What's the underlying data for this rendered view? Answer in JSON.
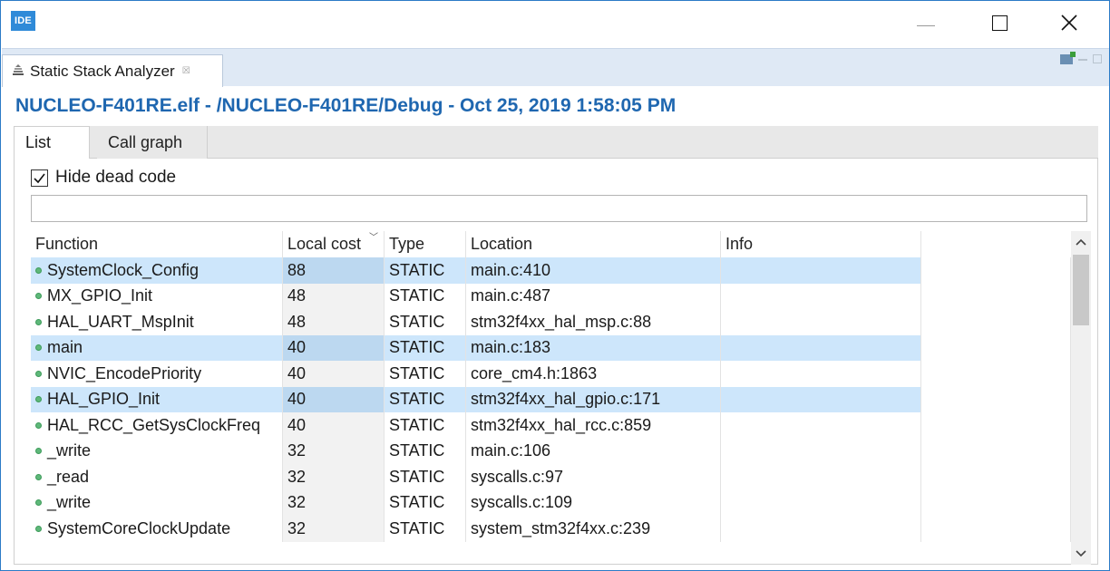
{
  "window": {
    "app_icon_text": "IDE",
    "minimize_icon": "minimize-icon",
    "maximize_icon": "maximize-icon",
    "close_glyph": "✕"
  },
  "view_tab": {
    "icon": "stack-analyzer-icon",
    "label": "Static Stack Analyzer",
    "close_glyph": "☒"
  },
  "header": {
    "title": "NUCLEO-F401RE.elf - /NUCLEO-F401RE/Debug - Oct 25, 2019 1:58:05 PM"
  },
  "tabs": [
    {
      "label": "List",
      "active": true
    },
    {
      "label": "Call graph",
      "active": false
    }
  ],
  "filter": {
    "hide_dead_code_label": "Hide dead code",
    "hide_dead_code_checked": true,
    "search_value": ""
  },
  "table": {
    "columns": [
      "Function",
      "Local cost",
      "Type",
      "Location",
      "Info"
    ],
    "sorted_column": "Local cost",
    "rows": [
      {
        "function": "SystemClock_Config",
        "cost": "88",
        "type": "STATIC",
        "location": "main.c:410",
        "info": "",
        "selected": true
      },
      {
        "function": "MX_GPIO_Init",
        "cost": "48",
        "type": "STATIC",
        "location": "main.c:487",
        "info": "",
        "selected": false
      },
      {
        "function": "HAL_UART_MspInit",
        "cost": "48",
        "type": "STATIC",
        "location": "stm32f4xx_hal_msp.c:88",
        "info": "",
        "selected": false
      },
      {
        "function": "main",
        "cost": "40",
        "type": "STATIC",
        "location": "main.c:183",
        "info": "",
        "selected": true
      },
      {
        "function": "NVIC_EncodePriority",
        "cost": "40",
        "type": "STATIC",
        "location": "core_cm4.h:1863",
        "info": "",
        "selected": false
      },
      {
        "function": "HAL_GPIO_Init",
        "cost": "40",
        "type": "STATIC",
        "location": "stm32f4xx_hal_gpio.c:171",
        "info": "",
        "selected": true
      },
      {
        "function": "HAL_RCC_GetSysClockFreq",
        "cost": "40",
        "type": "STATIC",
        "location": "stm32f4xx_hal_rcc.c:859",
        "info": "",
        "selected": false
      },
      {
        "function": "_write",
        "cost": "32",
        "type": "STATIC",
        "location": "main.c:106",
        "info": "",
        "selected": false
      },
      {
        "function": "_read",
        "cost": "32",
        "type": "STATIC",
        "location": "syscalls.c:97",
        "info": "",
        "selected": false
      },
      {
        "function": "_write",
        "cost": "32",
        "type": "STATIC",
        "location": "syscalls.c:109",
        "info": "",
        "selected": false
      },
      {
        "function": "SystemCoreClockUpdate",
        "cost": "32",
        "type": "STATIC",
        "location": "system_stm32f4xx.c:239",
        "info": "",
        "selected": false
      }
    ]
  },
  "colors": {
    "accent_title": "#1f67b0",
    "selection": "#cde6fb",
    "status_dot": "#5fb87a",
    "window_border": "#2b7bc7"
  }
}
